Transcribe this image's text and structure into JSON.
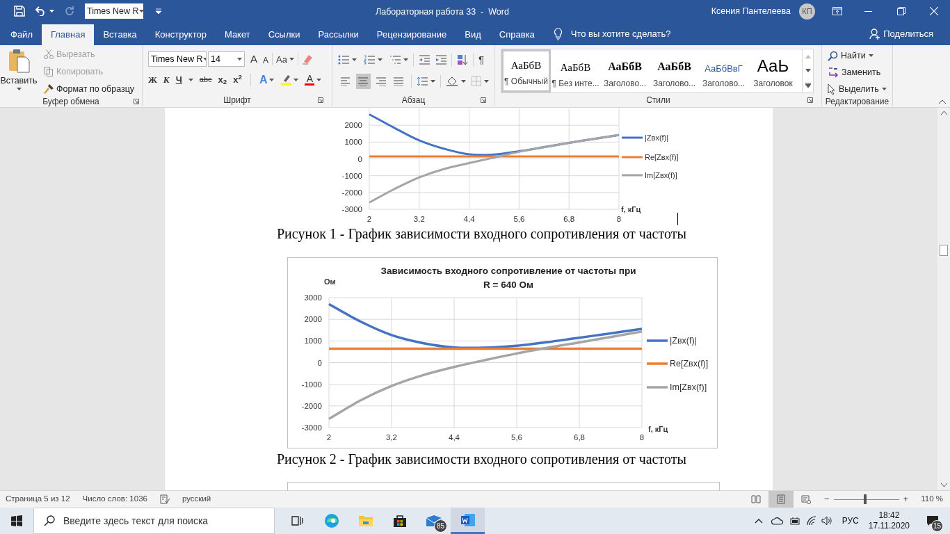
{
  "title_bar": {
    "font_box": "Times New R",
    "document_title": "Лабораторная работа 33  -  Word",
    "user_name": "Ксения Пантелеева",
    "avatar_initials": "КП"
  },
  "tabs": [
    {
      "label": "Файл",
      "selected": false
    },
    {
      "label": "Главная",
      "selected": true
    },
    {
      "label": "Вставка",
      "selected": false
    },
    {
      "label": "Конструктор",
      "selected": false
    },
    {
      "label": "Макет",
      "selected": false
    },
    {
      "label": "Ссылки",
      "selected": false
    },
    {
      "label": "Рассылки",
      "selected": false
    },
    {
      "label": "Рецензирование",
      "selected": false
    },
    {
      "label": "Вид",
      "selected": false
    },
    {
      "label": "Справка",
      "selected": false
    }
  ],
  "tell_me": "Что вы хотите сделать?",
  "share": "Поделиться",
  "ribbon": {
    "clipboard": {
      "label": "Буфер обмена",
      "paste": "Вставить",
      "commands": [
        {
          "label": "Вырезать",
          "disabled": true
        },
        {
          "label": "Копировать",
          "disabled": true
        },
        {
          "label": "Формат по образцу",
          "disabled": false
        }
      ]
    },
    "font": {
      "label": "Шрифт",
      "font_name": "Times New R",
      "font_size": "14",
      "grow": "A",
      "shrink": "A",
      "change_case": "Aa",
      "format_buttons": [
        "Ж",
        "К",
        "Ч",
        "abc",
        "x$_{2}$",
        "x$^{2}$"
      ],
      "text_effects": "A",
      "font_color": "A"
    },
    "paragraph": {
      "label": "Абзац",
      "show_marks": "¶",
      "alignments": [
        {
          "selected": false
        },
        {
          "selected": true
        },
        {
          "selected": false
        },
        {
          "selected": false
        }
      ]
    },
    "styles": {
      "label": "Стили",
      "items": [
        {
          "kind": "body",
          "sample": "АаБбВ",
          "name": "¶ Обычный",
          "selected": true
        },
        {
          "kind": "body",
          "sample": "АаБбВ",
          "name": "¶ Без инте...",
          "selected": false
        },
        {
          "kind": "heading",
          "sample": "АаБбВ",
          "name": "Заголово...",
          "selected": false
        },
        {
          "kind": "heading",
          "sample": "АаБбВ",
          "name": "Заголово...",
          "selected": false
        },
        {
          "kind": "accent",
          "sample": "АаБбВвГ",
          "name": "Заголово...",
          "selected": false
        },
        {
          "kind": "title",
          "sample": "АаЬ",
          "name": "Заголовок",
          "selected": false
        }
      ]
    },
    "editing": {
      "label": "Редактирование",
      "commands": [
        "Найти",
        "Заменить",
        "Выделить"
      ]
    }
  },
  "document": {
    "figures": [
      {
        "chart_data": {
          "type": "line",
          "grid": true,
          "legend": true,
          "xlabel": "f, кГц",
          "x": [
            2,
            2.6,
            3.2,
            3.8,
            4.4,
            5,
            5.6,
            6.2,
            6.8,
            7.4,
            8
          ],
          "xlim": [
            2,
            8
          ],
          "ylim": [
            -3000,
            3000
          ],
          "xticks": [
            {
              "value": 2,
              "label": "2"
            },
            {
              "value": 3.2,
              "label": "3,2"
            },
            {
              "value": 4.4,
              "label": "4,4"
            },
            {
              "value": 5.6,
              "label": "5,6"
            },
            {
              "value": 6.8,
              "label": "6,8"
            },
            {
              "value": 8,
              "label": "8"
            }
          ],
          "yticks": [
            -3000,
            -2000,
            -1000,
            0,
            1000,
            2000
          ],
          "series": [
            {
              "name": "|Zвх(f)|",
              "color": "#4472c4",
              "values": [
                2650,
                1850,
                1100,
                600,
                270,
                260,
                450,
                700,
                950,
                1190,
                1420
              ]
            },
            {
              "name": "Re[Zвх(f)]",
              "color": "#ed7d31",
              "values": [
                150,
                150,
                150,
                150,
                150,
                150,
                150,
                150,
                150,
                150,
                150
              ]
            },
            {
              "name": "Im[Zвх(f)]",
              "color": "#a5a5a5",
              "values": [
                -2600,
                -1800,
                -1100,
                -600,
                -250,
                80,
                420,
                690,
                950,
                1190,
                1430
              ]
            }
          ]
        },
        "caption": "Рисунок 1 - График зависимости входного сопротивления от частоты"
      },
      {
        "chart_data": {
          "type": "line",
          "grid": true,
          "legend": true,
          "title": "Зависимость входного сопротивление от частоты при R = 640 Ом",
          "xlabel": "f, кГц",
          "ylabel": "Ом",
          "x": [
            2,
            2.6,
            3.2,
            3.8,
            4.4,
            5,
            5.6,
            6.2,
            6.8,
            7.4,
            8
          ],
          "xlim": [
            2,
            8
          ],
          "ylim": [
            -3000,
            3000
          ],
          "xticks": [
            {
              "value": 2,
              "label": "2"
            },
            {
              "value": 3.2,
              "label": "3,2"
            },
            {
              "value": 4.4,
              "label": "4,4"
            },
            {
              "value": 5.6,
              "label": "5,6"
            },
            {
              "value": 6.8,
              "label": "6,8"
            },
            {
              "value": 8,
              "label": "8"
            }
          ],
          "yticks": [
            -3000,
            -2000,
            -1000,
            0,
            1000,
            2000,
            3000
          ],
          "series": [
            {
              "name": "|Zвх(f)|",
              "color": "#4472c4",
              "values": [
                2700,
                1900,
                1270,
                900,
                700,
                690,
                780,
                950,
                1150,
                1350,
                1560
              ]
            },
            {
              "name": "Re[Zвх(f)]",
              "color": "#ed7d31",
              "values": [
                640,
                640,
                640,
                640,
                640,
                640,
                640,
                640,
                640,
                640,
                640
              ]
            },
            {
              "name": "Im[Zвх(f)]",
              "color": "#a5a5a5",
              "values": [
                -2600,
                -1750,
                -1080,
                -580,
                -200,
                120,
                420,
                690,
                930,
                1180,
                1430
              ]
            }
          ]
        },
        "caption": "Рисунок 2 - График зависимости входного сопротивления от частоты"
      }
    ]
  },
  "status_bar": {
    "page": "Страница 5 из 12",
    "words": "Число слов: 1036",
    "language": "русский",
    "views": [
      {
        "selected": false
      },
      {
        "selected": true
      },
      {
        "selected": false
      }
    ],
    "zoom": {
      "zoom_out": "−",
      "zoom_in": "+",
      "level": 0.48,
      "reading": "110 %"
    }
  },
  "taskbar": {
    "search_placeholder": "Введите здесь текст для поиска",
    "mail_badge": "85",
    "language": "РУС",
    "time": "18:42",
    "date": "17.11.2020",
    "notifications": "15"
  }
}
